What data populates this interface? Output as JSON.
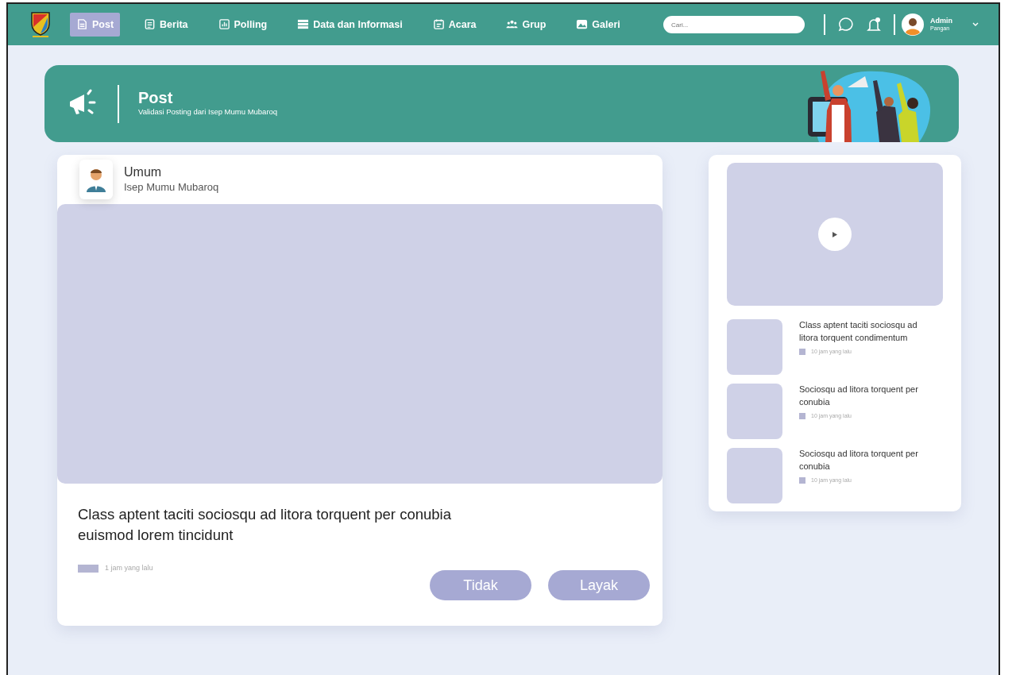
{
  "navbar": {
    "items": [
      {
        "label": "Post",
        "selected": true
      },
      {
        "label": "Berita",
        "selected": false
      },
      {
        "label": "Polling",
        "selected": false
      },
      {
        "label": "Data dan Informasi",
        "selected": false
      },
      {
        "label": "Acara",
        "selected": false
      },
      {
        "label": "Grup",
        "selected": false
      },
      {
        "label": "Galeri",
        "selected": false
      }
    ],
    "search": {
      "placeholder": "Cari..."
    },
    "notification_unread": true,
    "user": {
      "name": "Admin",
      "role": "Pangan"
    }
  },
  "banner": {
    "title": "Post",
    "subtitle": "Validasi Posting dari Isep Mumu Mubaroq"
  },
  "post": {
    "category": "Umum",
    "author": "Isep Mumu Mubaroq",
    "text": "Class aptent taciti sociosqu ad litora torquent per conubia euismod lorem tincidunt",
    "time": "1 jam yang lalu",
    "buttons": [
      {
        "label": "Tidak",
        "disabled": true
      },
      {
        "label": "Layak",
        "disabled": true
      }
    ]
  },
  "sidebar": {
    "media": {
      "kind": "video"
    },
    "items": [
      {
        "title": "Class aptent taciti sociosqu ad litora torquent condimentum",
        "time": "10 jam yang lalu"
      },
      {
        "title": "Sociosqu ad litora torquent per conubia",
        "time": "10 jam yang lalu"
      },
      {
        "title": "Sociosqu ad litora torquent per conubia",
        "time": "10 jam yang lalu"
      }
    ]
  }
}
